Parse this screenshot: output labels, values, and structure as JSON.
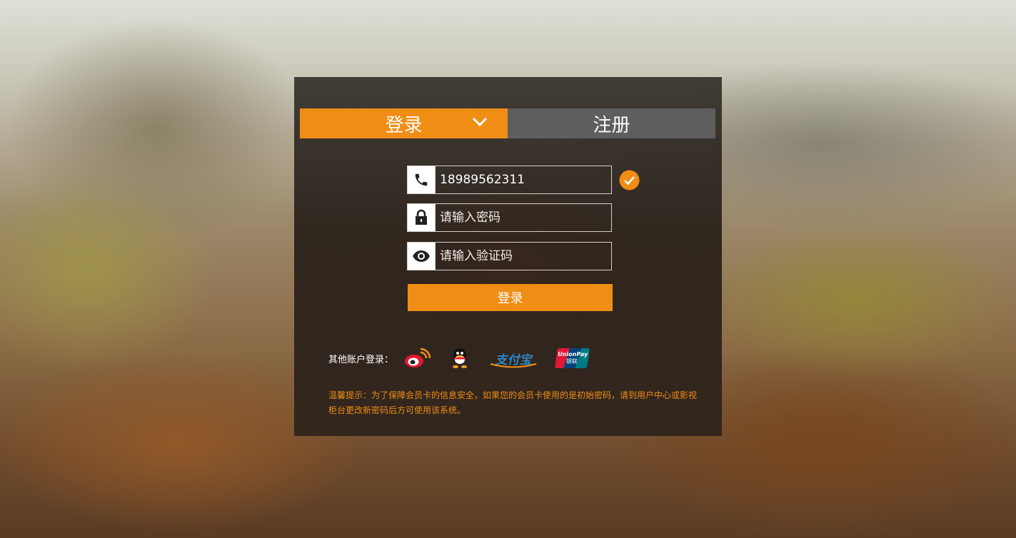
{
  "tabs": {
    "login": "登录",
    "register": "注册"
  },
  "form": {
    "phone_value": "18989562311",
    "password_placeholder": "请输入密码",
    "captcha_placeholder": "请输入验证码",
    "submit_label": "登录"
  },
  "other_login": {
    "label": "其他账户登录：",
    "providers": [
      "weibo-icon",
      "qq-icon",
      "alipay-icon",
      "unionpay-icon"
    ],
    "alipay_text": "支付宝",
    "unionpay_text": "UnionPay",
    "unionpay_sub": "银联"
  },
  "tip": "温馨提示：为了保障会员卡的信息安全，如果您的会员卡使用的是初始密码，请到用户中心或影视柜台更改新密码后方可使用该系统。",
  "colors": {
    "accent": "#f08d15",
    "inactive_tab": "#5e5e5e"
  }
}
